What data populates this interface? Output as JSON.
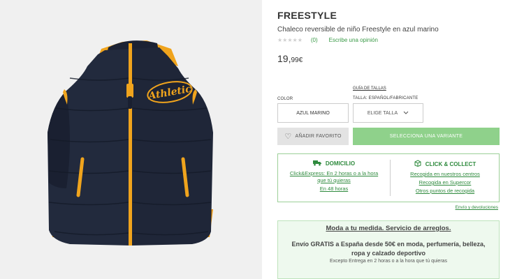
{
  "product": {
    "brand": "FREESTYLE",
    "subtitle": "Chaleco reversible de niño Freestyle en azul marino",
    "stars": "★★★★★",
    "reviews_count": "(0)",
    "write_review": "Escribe una opinión",
    "price_int": "19,",
    "price_dec": "99€",
    "image_text": "Athletic"
  },
  "options": {
    "size_guide": "GUÍA DE TALLAS",
    "color_label": "COLOR",
    "size_label": "TALLA: ESPAÑOL/FABRICANTE",
    "color_value": "AZUL MARINO",
    "size_placeholder": "ELIGE TALLA",
    "favorite_button": "AÑADIR FAVORITO",
    "variant_button": "SELECCIONA UNA VARIANTE"
  },
  "delivery": {
    "home_title": "DOMICILIO",
    "home_links": [
      "Click&Express: En 2 horas o a la hora",
      "que tú quieras",
      "En 48 horas"
    ],
    "collect_title": "CLICK & COLLECT",
    "collect_links": [
      "Recogida en nuestros centros",
      "Recogida en Supercor",
      "Otros puntos de recogida"
    ],
    "shipping_link": "Envío y devoluciones"
  },
  "promo": {
    "title": "Moda a tu medida. Servicio de arreglos.",
    "body": "Envío GRATIS a España desde 50€ en moda, perfumería, belleza, ropa y calzado deportivo",
    "note": "Excepto Entrega en 2 horas o a la hora que tú quieras"
  },
  "colors": {
    "accent_green": "#3a9a47",
    "button_green": "#8fd18b",
    "vest_navy": "#1f2638",
    "vest_orange": "#f0a41d"
  }
}
